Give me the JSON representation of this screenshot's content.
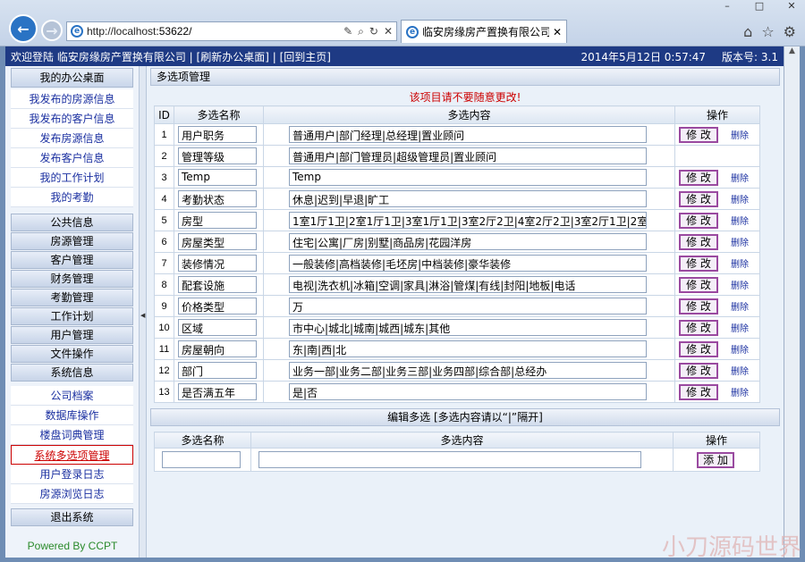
{
  "browser": {
    "url_host": "http://localhost",
    "url_port": ":53622/",
    "tab_title": "临安房缘房产置换有限公司...",
    "controls": {
      "minimize": "–",
      "maximize": "□",
      "close": "✕"
    }
  },
  "header": {
    "welcome": "欢迎登陆 临安房缘房产置换有限公司",
    "links": [
      "[刷新办公桌面]",
      "[回到主页]"
    ],
    "datetime": "2014年5月12日  0:57:47",
    "version": "版本号: 3.1"
  },
  "sidebar": {
    "desk_title": "我的办公桌面",
    "desk_items": [
      "我发布的房源信息",
      "我发布的客户信息",
      "发布房源信息",
      "发布客户信息",
      "我的工作计划",
      "我的考勤"
    ],
    "groups": [
      "公共信息",
      "房源管理",
      "客户管理",
      "财务管理",
      "考勤管理",
      "工作计划",
      "用户管理",
      "文件操作",
      "系统信息"
    ],
    "system_items": [
      "公司档案",
      "数据库操作",
      "楼盘词典管理",
      "系统多选项管理",
      "用户登录日志",
      "房源浏览日志"
    ],
    "exit": "退出系统",
    "powered": "Powered By CCPT"
  },
  "main": {
    "title": "多选项管理",
    "warning": "该项目请不要随意更改!",
    "columns": {
      "id": "ID",
      "name": "多选名称",
      "content": "多选内容",
      "ops": "操作"
    },
    "edit_label": "修 改",
    "delete_label": "删除",
    "rows": [
      {
        "id": "1",
        "name": "用户职务",
        "content": "普通用户|部门经理|总经理|置业顾问",
        "editable": true
      },
      {
        "id": "2",
        "name": "管理等级",
        "content": "普通用户|部门管理员|超级管理员|置业顾问",
        "editable": false
      },
      {
        "id": "3",
        "name": "Temp",
        "content": "Temp",
        "editable": true
      },
      {
        "id": "4",
        "name": "考勤状态",
        "content": "休息|迟到|早退|旷工",
        "editable": true
      },
      {
        "id": "5",
        "name": "房型",
        "content": "1室1厅1卫|2室1厅1卫|3室1厅1卫|3室2厅2卫|4室2厅2卫|3室2厅1卫|2室2",
        "editable": true
      },
      {
        "id": "6",
        "name": "房屋类型",
        "content": "住宅|公寓|厂房|别墅|商品房|花园洋房",
        "editable": true
      },
      {
        "id": "7",
        "name": "装修情况",
        "content": "一般装修|高档装修|毛坯房|中档装修|豪华装修",
        "editable": true
      },
      {
        "id": "8",
        "name": "配套设施",
        "content": "电视|洗衣机|冰箱|空调|家具|淋浴|管煤|有线|封阳|地板|电话",
        "editable": true
      },
      {
        "id": "9",
        "name": "价格类型",
        "content": "万",
        "editable": true
      },
      {
        "id": "10",
        "name": "区域",
        "content": "市中心|城北|城南|城西|城东|其他",
        "editable": true
      },
      {
        "id": "11",
        "name": "房屋朝向",
        "content": "东|南|西|北",
        "editable": true
      },
      {
        "id": "12",
        "name": "部门",
        "content": "业务一部|业务二部|业务三部|业务四部|综合部|总经办",
        "editable": true
      },
      {
        "id": "13",
        "name": "是否满五年",
        "content": "是|否",
        "editable": true
      }
    ],
    "edit_section": {
      "title": "编辑多选 [多选内容请以“|”隔开]",
      "name_header": "多选名称",
      "content_header": "多选内容",
      "ops_header": "操作",
      "add_label": "添 加"
    }
  },
  "watermark": "小刀源码世界",
  "colors": {
    "header_bg": "#1e3a84",
    "link": "#1a2fa0",
    "warning": "#cc0000",
    "button_border": "#9a4aa0"
  }
}
